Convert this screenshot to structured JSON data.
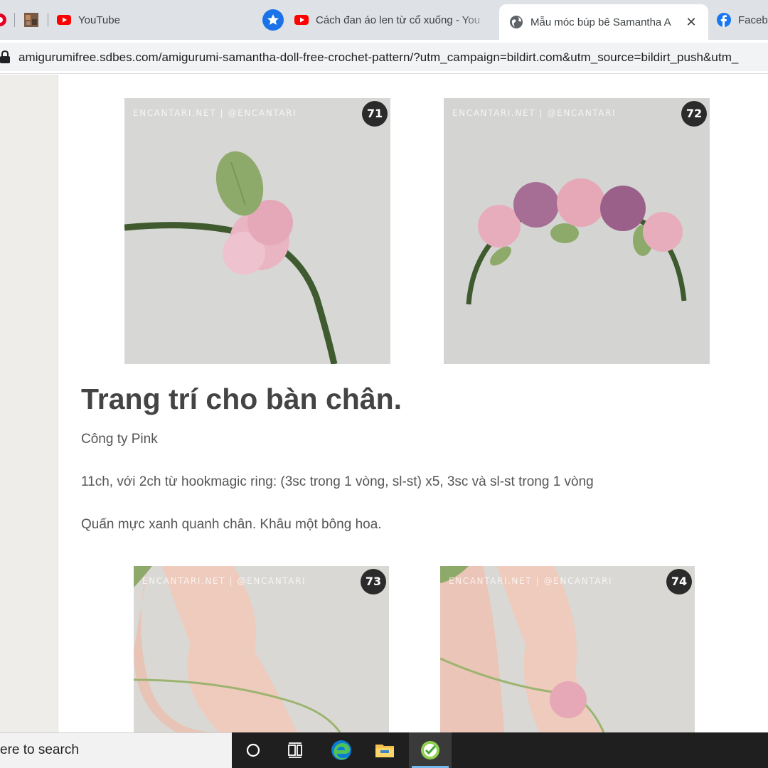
{
  "browser": {
    "tabs": [
      {
        "label": "",
        "icon": "pinterest-icon"
      },
      {
        "label": "",
        "icon": "thumbnail-icon"
      },
      {
        "label": "YouTube",
        "icon": "youtube-icon"
      },
      {
        "label": "Cách đan áo len từ cổ xuống - You",
        "icon": "youtube-icon"
      },
      {
        "label": "Mẫu móc búp bê Samantha A",
        "icon": "globe-icon",
        "active": true
      },
      {
        "label": "Faceb",
        "icon": "facebook-icon"
      }
    ],
    "close_glyph": "✕",
    "url": "amigurumifree.sdbes.com/amigurumi-samantha-doll-free-crochet-pattern/?utm_campaign=bildirt.com&utm_source=bildirt_push&utm_"
  },
  "content": {
    "photos": [
      {
        "watermark": "ENCANTARI.NET | @ENCANTARI",
        "number": "71"
      },
      {
        "watermark": "ENCANTARI.NET | @ENCANTARI",
        "number": "72"
      },
      {
        "watermark": "ENCANTARI.NET | @ENCANTARI",
        "number": "73"
      },
      {
        "watermark": "ENCANTARI.NET | @ENCANTARI",
        "number": "74"
      }
    ],
    "heading": "Trang trí cho bàn chân.",
    "paragraphs": [
      "Công ty Pink",
      "11ch, với 2ch từ hookmagic ring: (3sc trong 1 vòng, sl-st) x5, 3sc và sl-st trong 1 vòng",
      "Quấn mực xanh quanh chân. Khâu một bông hoa."
    ]
  },
  "taskbar": {
    "search_text": "ere to search",
    "apps": [
      "task-view-icon",
      "edge-icon",
      "file-explorer-icon",
      "app-icon"
    ]
  },
  "colors": {
    "tab_strip": "#dee1e6",
    "youtube_red": "#ff0000",
    "facebook_blue": "#1877f2",
    "heading": "#444444",
    "body_text": "#555555",
    "taskbar": "#1f1f1f"
  }
}
